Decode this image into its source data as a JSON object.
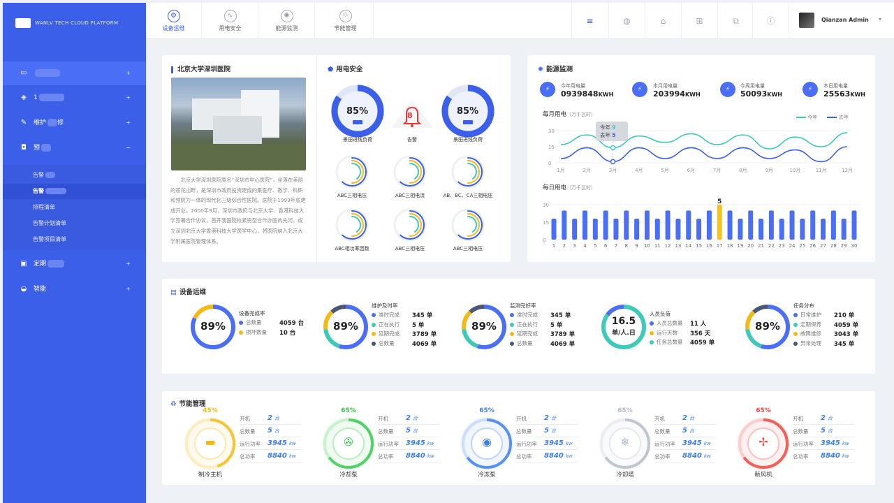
{
  "sidebar": {
    "brand": "WANLV TECH CLOUD PLATFORM",
    "items": [
      {
        "label": "",
        "icon": "monitor-icon",
        "plus": "+"
      },
      {
        "label": "1",
        "icon": "layers-icon",
        "plus": "+"
      },
      {
        "label": "维护",
        "suffix": "修",
        "icon": "wrench-icon",
        "plus": "+"
      },
      {
        "label": "预",
        "icon": "alert-icon",
        "plus": "−"
      },
      {
        "label": "定期",
        "icon": "calendar-icon",
        "plus": "+"
      },
      {
        "label": "智能",
        "icon": "smart-icon",
        "plus": "+"
      }
    ],
    "subitems": [
      "告警",
      "告警",
      "排程清单",
      "告警计划清单",
      "告警项目清单"
    ]
  },
  "topbar": {
    "tabs": [
      {
        "label": "设备运维",
        "icon": "gear-icon"
      },
      {
        "label": "用电安全",
        "icon": "wave-icon"
      },
      {
        "label": "能源监测",
        "icon": "atom-icon"
      },
      {
        "label": "节能管理",
        "icon": "recycle-icon"
      }
    ],
    "user": "Qianzan Admin"
  },
  "hospital": {
    "title": "北京大学深圳医院",
    "description": "北京大学深圳医院原名“深圳市中心医院”，坐落在美丽的莲花山畔，是深圳市政府投资建成的集医疗、教学、科研和预防为一体的现代化三级综合性医院。医院于1999年底建成开业。2000年9月，深圳市政府与北京大学、香港科技大学签署合作协议，首开我国院校紧密型合作办医的先河，成立深圳北京大学香港科技大学医学中心，将医院纳入北京大学附属医院管理体系。"
  },
  "safety": {
    "title": "用电安全",
    "gauges": [
      {
        "label": "景田进线负荷",
        "value": "85%",
        "pct": 85
      },
      {
        "label": "告警",
        "value": "8"
      },
      {
        "label": "景田进线负荷",
        "value": "85%",
        "pct": 85
      }
    ],
    "small_rings": [
      {
        "label": "ABC三相电压"
      },
      {
        "label": "ABC三相电流"
      },
      {
        "label": "AB、BC、CA三相电压"
      },
      {
        "label": "ABC相功率因数"
      },
      {
        "label": "ABC三相电压"
      },
      {
        "label": "ABC三相电压"
      }
    ]
  },
  "energy": {
    "title": "能源监测",
    "stats": [
      {
        "label": "今年用电量",
        "value": "0939848",
        "unit": "KWH"
      },
      {
        "label": "本月用电量",
        "value": "203994",
        "unit": "KWH"
      },
      {
        "label": "今周用电量",
        "value": "50093",
        "unit": "KWH"
      },
      {
        "label": "本日用电量",
        "value": "25563",
        "unit": "KWH"
      }
    ],
    "monthly_title": "每月用电",
    "monthly_unit": "（万千瓦时）",
    "daily_title": "每日用电",
    "daily_unit": "（万千瓦时）",
    "legend_this": "今年",
    "legend_last": "去年",
    "tooltip": {
      "this_label": "今年",
      "this_value": "9",
      "last_label": "去年",
      "last_value": "5"
    },
    "peak_label": "5"
  },
  "chart_data": [
    {
      "type": "line",
      "title": "每月用电",
      "x": [
        "1月",
        "2月",
        "3月",
        "4月",
        "5月",
        "6月",
        "7月",
        "8月",
        "9月",
        "10月",
        "11月",
        "12月"
      ],
      "series": [
        {
          "name": "今年",
          "values": [
            17,
            26,
            14,
            25,
            19,
            27,
            17,
            26,
            13,
            24,
            15,
            28
          ]
        },
        {
          "name": "去年",
          "values": [
            4,
            14,
            1,
            14,
            4,
            14,
            4,
            14,
            4,
            12,
            1,
            15
          ]
        }
      ],
      "ylim": [
        0,
        30
      ],
      "yticks": [
        0,
        15,
        30
      ]
    },
    {
      "type": "bar",
      "title": "每日用电",
      "categories": [
        "1",
        "2",
        "3",
        "4",
        "5",
        "6",
        "7",
        "8",
        "9",
        "10",
        "11",
        "12",
        "13",
        "14",
        "15",
        "16",
        "17",
        "18",
        "19",
        "20",
        "21",
        "22",
        "23",
        "24",
        "25",
        "26",
        "27",
        "28",
        "29",
        "30"
      ],
      "values": [
        18,
        25,
        18,
        25,
        18,
        25,
        18,
        25,
        18,
        25,
        18,
        25,
        18,
        25,
        18,
        25,
        30,
        25,
        18,
        25,
        18,
        25,
        18,
        25,
        18,
        25,
        18,
        25,
        18,
        25
      ],
      "highlight_index": 16,
      "ylim": [
        0,
        30
      ],
      "yticks": [
        0,
        15,
        30
      ]
    }
  ],
  "ops": {
    "title": "设备运维",
    "groups": [
      {
        "title": "设备完成率",
        "center": "89%",
        "rows": [
          {
            "label": "总数量",
            "value": "4059 台",
            "color": "#4a6ef5"
          },
          {
            "label": "损坏数量",
            "value": "10 台",
            "color": "#f5b915"
          }
        ]
      },
      {
        "title": "维护及时率",
        "center": "89%",
        "rows": [
          {
            "label": "准时完成",
            "value": "345 单",
            "color": "#4a6ef5"
          },
          {
            "label": "正在执行",
            "value": "5 单",
            "color": "#3fc9b8"
          },
          {
            "label": "延期完成",
            "value": "3789 单",
            "color": "#f5b915"
          },
          {
            "label": "总数量",
            "value": "4069 单",
            "color": "#4b5875"
          }
        ]
      },
      {
        "title": "监测完好率",
        "center": "89%",
        "rows": [
          {
            "label": "准时完成",
            "value": "345 单",
            "color": "#4a6ef5"
          },
          {
            "label": "正在执行",
            "value": "5 单",
            "color": "#3fc9b8"
          },
          {
            "label": "延期完成",
            "value": "3789 单",
            "color": "#f5b915"
          },
          {
            "label": "总数量",
            "value": "4069 单",
            "color": "#4b5875"
          }
        ]
      },
      {
        "title": "人员负荷",
        "center": "16.5",
        "center_sub": "单/人.日",
        "rows": [
          {
            "label": "人员总数量",
            "value": "11 人",
            "color": "#4a6ef5"
          },
          {
            "label": "运行天数",
            "value": "356 天",
            "color": "#f5b915"
          },
          {
            "label": "任务总数量",
            "value": "4059 单",
            "color": "#3fc9b8"
          }
        ]
      },
      {
        "title": "任务分布",
        "center": "89%",
        "rows": [
          {
            "label": "日常维护",
            "value": "210 单",
            "color": "#4a6ef5"
          },
          {
            "label": "定期保养",
            "value": "4059 单",
            "color": "#3fc9b8"
          },
          {
            "label": "故障维修",
            "value": "3043 单",
            "color": "#f5b915"
          },
          {
            "label": "异常处理",
            "value": "345 单",
            "color": "#4b5875"
          }
        ]
      }
    ]
  },
  "saving": {
    "title": "节能管理",
    "equipment": [
      {
        "name": "制冷主机",
        "pct": "45%",
        "color": "#f5b915",
        "icon": "chiller-icon",
        "open": "2",
        "total": "5",
        "run": "3945",
        "power": "8840"
      },
      {
        "name": "冷却泵",
        "pct": "65%",
        "color": "#33c94c",
        "icon": "fan-pump-icon",
        "open": "2",
        "total": "5",
        "run": "3945",
        "power": "8840"
      },
      {
        "name": "冷冻泵",
        "pct": "65%",
        "color": "#3b7ef0",
        "icon": "pump-icon",
        "open": "2",
        "total": "5",
        "run": "3945",
        "power": "8840"
      },
      {
        "name": "冷却塔",
        "pct": "65%",
        "color": "#b4bcc8",
        "icon": "tower-icon",
        "open": "2",
        "total": "5",
        "run": "3945",
        "power": "8840"
      },
      {
        "name": "新风机",
        "pct": "65%",
        "color": "#f0453d",
        "icon": "fresh-air-icon",
        "open": "2",
        "total": "5",
        "run": "3945",
        "power": "8840"
      }
    ],
    "labels": {
      "open": "开机",
      "total": "总数量",
      "run": "运行功率",
      "power": "总功率",
      "unit_tai": "台",
      "unit_kw": "kw"
    }
  }
}
